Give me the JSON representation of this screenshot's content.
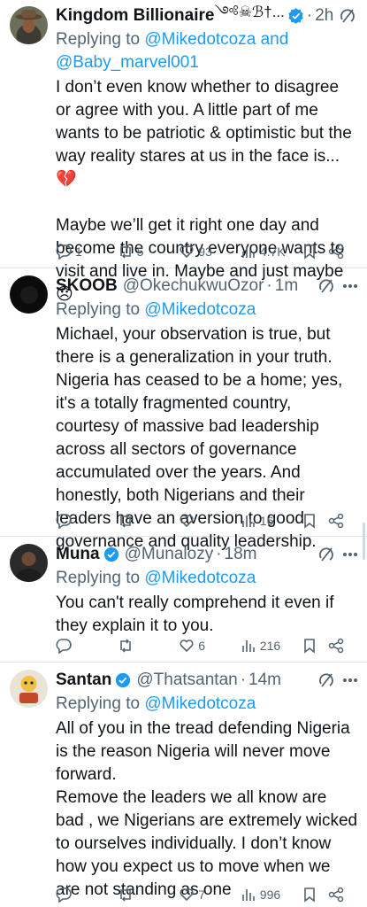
{
  "colors": {
    "link": "#1d9bf0",
    "muted": "#536471",
    "verified": "#1d9bf0"
  },
  "tweets": [
    {
      "name": "Kingdom Billionaire",
      "name_suffix": "༺☠︎︎ℬ†...",
      "verified": true,
      "handle": "",
      "time": "2h",
      "replying_prefix": "Replying to",
      "mention1": "@Mikedotcoza",
      "and_text": "and",
      "mention2": "@Baby_marvel001",
      "text": "I don’t even know whether to disagree or agree with you. A little part of me wants to be patriotic & optimistic but the way reality stares at us in the face is...💔\n\nMaybe we’ll get it right one day and become the country everyone wants to visit and live in. Maybe and just maybe😞",
      "replies": "1",
      "retweets": "5",
      "likes": "93",
      "views": "4.7K",
      "avatar_icon": "avatar-cowboy-hat"
    },
    {
      "name": "SKOOB",
      "verified": false,
      "handle": "@OkechukwuOzor",
      "time": "1m",
      "replying_prefix": "Replying to",
      "mention1": "@Mikedotcoza",
      "text": "Michael, your observation is true, but there is a generalization in your truth. Nigeria has ceased to be a home; yes, it's a totally fragmented country, courtesy of massive bad leadership across all sectors of governance accumulated over the years. And honestly, both Nigerians and their leaders have an aversion to good governance and quality leadership.",
      "replies": "",
      "retweets": "",
      "likes": "",
      "views": "16",
      "avatar_icon": "avatar-dark"
    },
    {
      "name": "Muna",
      "verified": true,
      "handle": "@Munalozy",
      "time": "18m",
      "replying_prefix": "Replying to",
      "mention1": "@Mikedotcoza",
      "text": "You can't really comprehend it even if they explain it to you.",
      "replies": "",
      "retweets": "",
      "likes": "6",
      "views": "216",
      "avatar_icon": "avatar-person"
    },
    {
      "name": "Santan",
      "verified": true,
      "handle": "@Thatsantan",
      "time": "14m",
      "replying_prefix": "Replying to",
      "mention1": "@Mikedotcoza",
      "text": "All of you in the tread defending Nigeria is the reason Nigeria will never move forward.\nRemove the leaders we all know are bad , we Nigerians are extremely wicked to ourselves individually. I don’t know how you expect us to move when we are not standing as one",
      "replies": "",
      "retweets": "",
      "likes": "7",
      "views": "996",
      "avatar_icon": "avatar-cartoon"
    }
  ]
}
